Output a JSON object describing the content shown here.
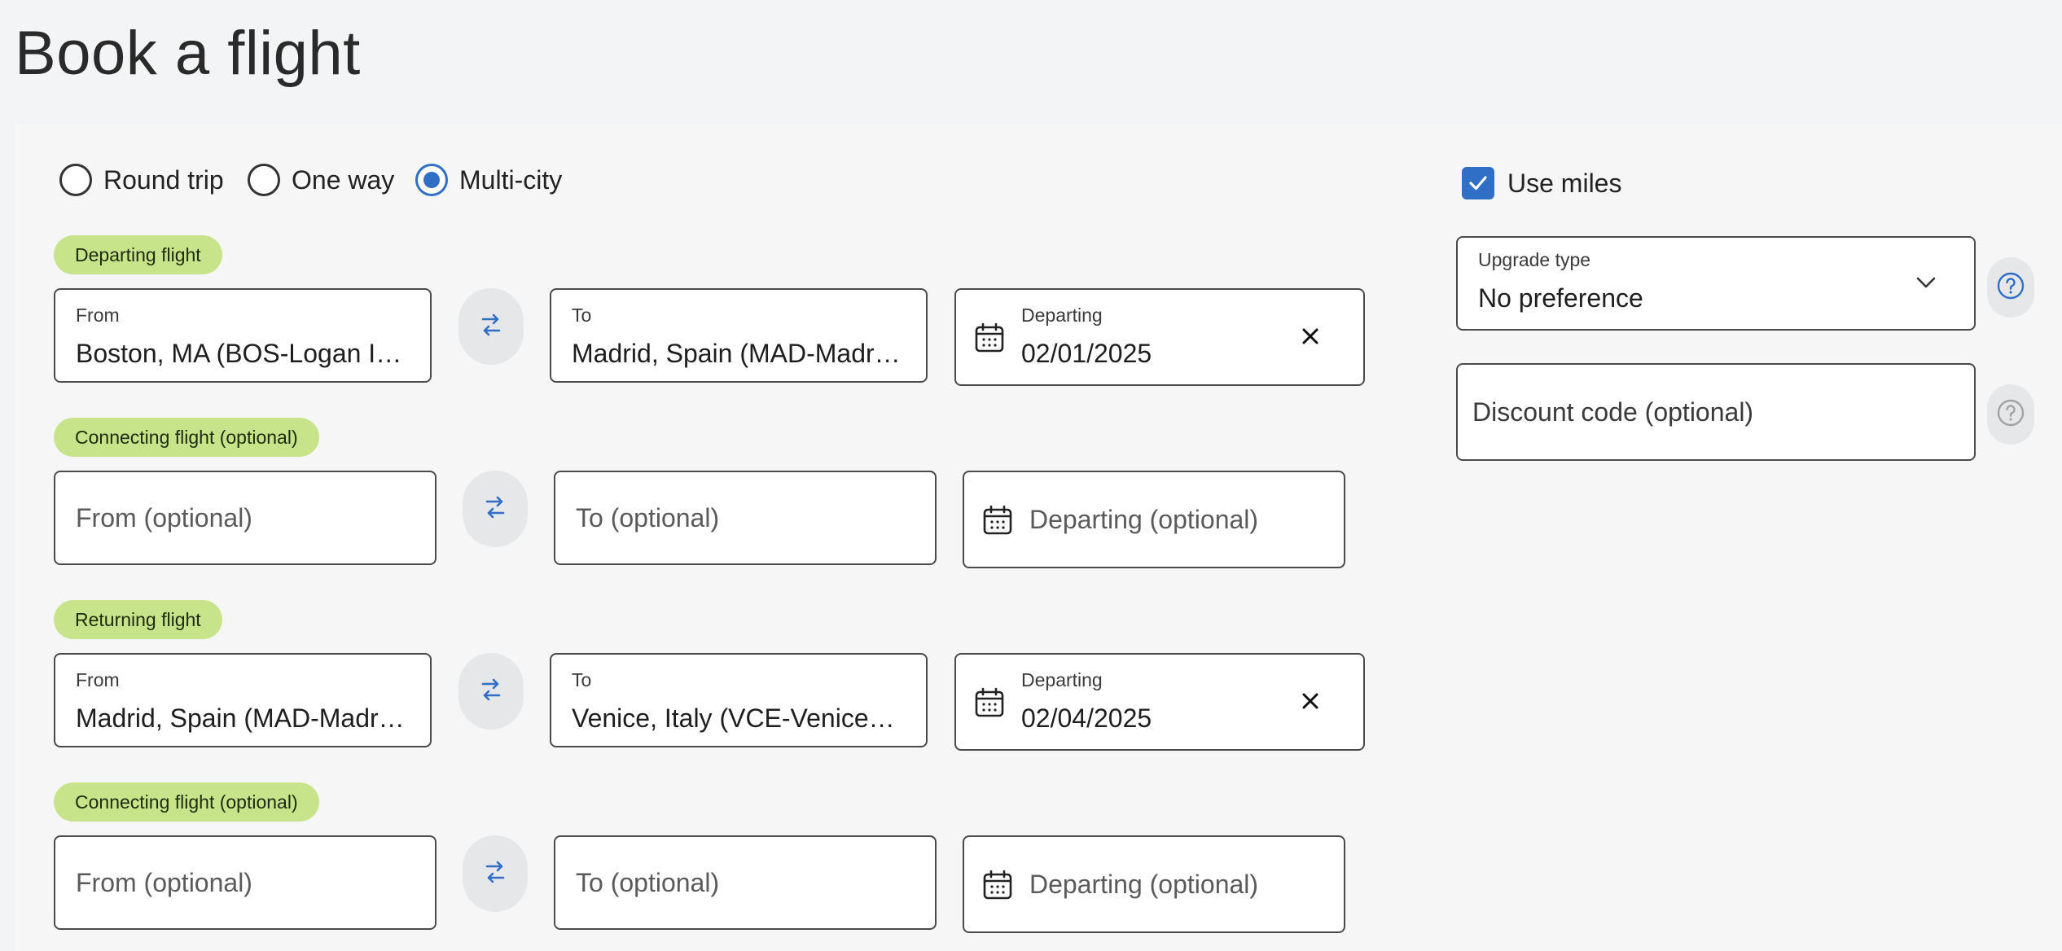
{
  "page": {
    "title": "Book a flight"
  },
  "trip_type": {
    "options": [
      {
        "label": "Round trip",
        "selected": false
      },
      {
        "label": "One way",
        "selected": false
      },
      {
        "label": "Multi-city",
        "selected": true
      }
    ]
  },
  "use_miles": {
    "label": "Use miles",
    "checked": true
  },
  "upgrade": {
    "label": "Upgrade type",
    "value": "No preference"
  },
  "discount": {
    "placeholder": "Discount code (optional)"
  },
  "segments": [
    {
      "badge": "Departing flight",
      "from": {
        "label": "From",
        "value": "Boston, MA (BOS-Logan International)"
      },
      "to": {
        "label": "To",
        "value": "Madrid, Spain (MAD-Madrid Barajas)"
      },
      "date": {
        "label": "Departing",
        "value": "02/01/2025"
      }
    },
    {
      "badge": "Connecting flight (optional)",
      "from": {
        "placeholder": "From (optional)"
      },
      "to": {
        "placeholder": "To (optional)"
      },
      "date": {
        "placeholder": "Departing (optional)"
      }
    },
    {
      "badge": "Returning flight",
      "from": {
        "label": "From",
        "value": "Madrid, Spain (MAD-Madrid Barajas)"
      },
      "to": {
        "label": "To",
        "value": "Venice, Italy (VCE-Venice Marco Polo)"
      },
      "date": {
        "label": "Departing",
        "value": "02/04/2025"
      }
    },
    {
      "badge": "Connecting flight (optional)",
      "from": {
        "placeholder": "From (optional)"
      },
      "to": {
        "placeholder": "To (optional)"
      },
      "date": {
        "placeholder": "Departing (optional)"
      }
    }
  ],
  "colors": {
    "accent": "#2f6fc6",
    "badge_bg": "#c8e48a",
    "background": "#f3f4f5"
  }
}
